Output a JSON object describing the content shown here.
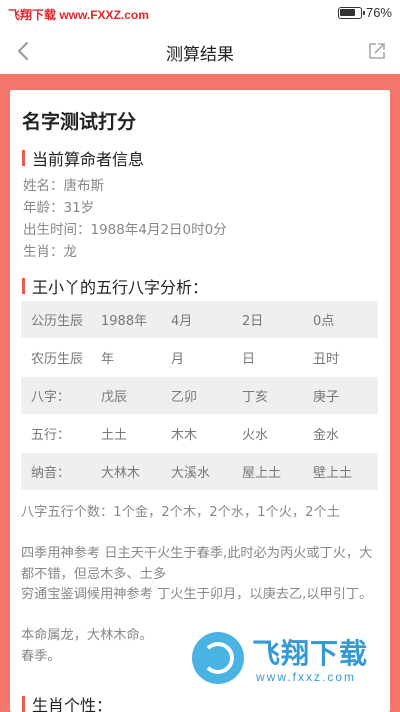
{
  "status_bar": {
    "watermark": "飞翔下载 www.FXXZ.com",
    "battery_level": 0.76,
    "battery_text": "76%"
  },
  "nav": {
    "title": "测算结果",
    "back_icon": "chevron-left-icon",
    "share_icon": "share-icon"
  },
  "card": {
    "title": "名字测试打分",
    "section_info": "当前算命者信息",
    "info": [
      {
        "label": "姓名：",
        "value": "唐布斯"
      },
      {
        "label": "年龄：",
        "value": "31岁"
      },
      {
        "label": "出生时间：",
        "value": "1988年4月2日0时0分"
      },
      {
        "label": "生肖：",
        "value": "龙"
      }
    ],
    "section_wuxing": "王小丫的五行八字分析：",
    "table": [
      [
        "公历生辰",
        "1988年",
        "4月",
        "2日",
        "0点"
      ],
      [
        "农历生辰",
        "年",
        "月",
        "日",
        "丑时"
      ],
      [
        "八字：",
        "戊辰",
        "乙卯",
        "丁亥",
        "庚子"
      ],
      [
        "五行：",
        "土土",
        "木木",
        "火水",
        "金水"
      ],
      [
        "纳音：",
        "大林木",
        "大溪水",
        "屋上土",
        "壁上土"
      ]
    ],
    "analysis": [
      "八字五行个数：1个金，2个木，2个水，1个火，2个土",
      "四季用神参考  日主天干火生于春季,此时必为丙火或丁火，大都不错，但忌木多、土多",
      "穷通宝鉴调候用神参考  丁火生于卯月，以庚去乙,以甲引丁。",
      "本命属龙，大林木命。",
      "春季。"
    ],
    "section_shengxiao": "生肖个性："
  },
  "watermark_bottom": {
    "text": "飞翔下载",
    "url": "www.fxxz.com"
  },
  "colors": {
    "accent_red": "#f2776a",
    "section_bar": "#ec5a4d",
    "watermark_blue": "#1f8ed0"
  }
}
